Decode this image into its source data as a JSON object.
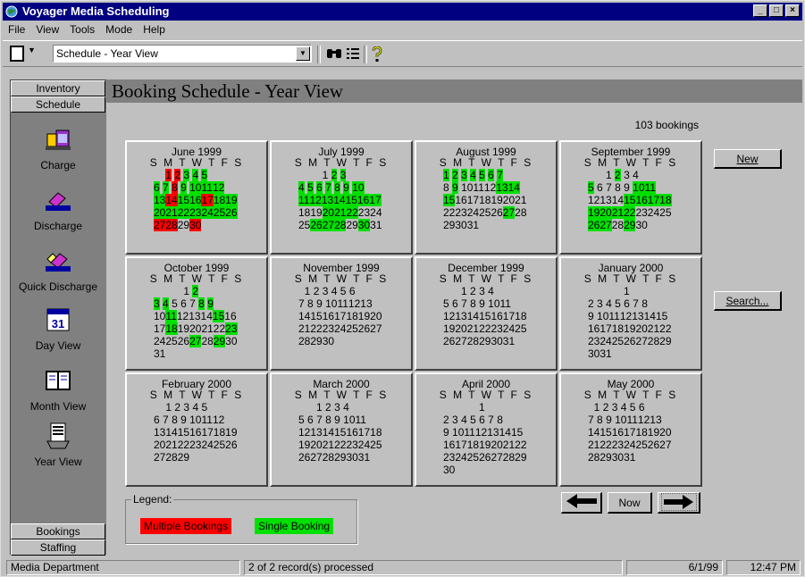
{
  "window": {
    "title": "Voyager Media Scheduling"
  },
  "menu": [
    {
      "label": "File"
    },
    {
      "label": "View"
    },
    {
      "label": "Tools"
    },
    {
      "label": "Mode"
    },
    {
      "label": "Help"
    }
  ],
  "toolbar": {
    "view_select_value": "Schedule - Year View"
  },
  "sidebar": {
    "top_buttons": [
      "Inventory",
      "Schedule"
    ],
    "items": [
      {
        "label": "Charge",
        "icon": "charge-icon"
      },
      {
        "label": "Discharge",
        "icon": "discharge-icon"
      },
      {
        "label": "Quick Discharge",
        "icon": "quick-discharge-icon"
      },
      {
        "label": "Day View",
        "icon": "day-view-icon"
      },
      {
        "label": "Month View",
        "icon": "month-view-icon"
      },
      {
        "label": "Year View",
        "icon": "year-view-icon"
      }
    ],
    "bottom_buttons": [
      "Bookings",
      "Staffing"
    ],
    "day_icon_number": "31"
  },
  "main": {
    "title": "Booking Schedule - Year View",
    "bookings_count": "103 bookings",
    "dow_header": "S M T W T F S",
    "months": [
      {
        "name": "June 1999",
        "start": 2,
        "days": 30,
        "multiple": [
          1,
          2,
          8,
          14,
          17,
          27,
          28,
          30
        ],
        "single": [
          3,
          4,
          5,
          6,
          7,
          9,
          10,
          11,
          12,
          13,
          15,
          16,
          18,
          19,
          20,
          21,
          22,
          23,
          24,
          25,
          26
        ]
      },
      {
        "name": "July 1999",
        "start": 4,
        "days": 31,
        "multiple": [],
        "single": [
          2,
          3,
          4,
          5,
          6,
          7,
          8,
          9,
          10,
          11,
          12,
          13,
          14,
          15,
          16,
          17,
          20,
          21,
          22,
          26,
          27,
          28,
          30
        ]
      },
      {
        "name": "August 1999",
        "start": 0,
        "days": 31,
        "multiple": [],
        "single": [
          1,
          2,
          3,
          4,
          5,
          6,
          7,
          9,
          13,
          14,
          15,
          27
        ]
      },
      {
        "name": "September 1999",
        "start": 3,
        "days": 30,
        "multiple": [],
        "single": [
          2,
          5,
          10,
          11,
          15,
          16,
          17,
          18,
          19,
          20,
          21,
          22,
          26,
          27,
          29
        ]
      },
      {
        "name": "October 1999",
        "start": 5,
        "days": 31,
        "multiple": [],
        "single": [
          2,
          3,
          4,
          8,
          9,
          11,
          15,
          18,
          23,
          27,
          29
        ]
      },
      {
        "name": "November 1999",
        "start": 1,
        "days": 30,
        "multiple": [],
        "single": []
      },
      {
        "name": "December 1999",
        "start": 3,
        "days": 31,
        "multiple": [],
        "single": []
      },
      {
        "name": "January 2000",
        "start": 6,
        "days": 31,
        "multiple": [],
        "single": []
      },
      {
        "name": "February 2000",
        "start": 2,
        "days": 29,
        "multiple": [],
        "single": []
      },
      {
        "name": "March 2000",
        "start": 3,
        "days": 31,
        "multiple": [],
        "single": []
      },
      {
        "name": "April 2000",
        "start": 6,
        "days": 30,
        "multiple": [],
        "single": []
      },
      {
        "name": "May 2000",
        "start": 1,
        "days": 31,
        "multiple": [],
        "single": []
      }
    ],
    "buttons": {
      "new": "New",
      "search": "Search...",
      "now": "Now"
    },
    "legend": {
      "title": "Legend:",
      "multiple_label": "Multiple Bookings",
      "single_label": "Single Booking",
      "multiple_color": "#ff0000",
      "single_color": "#00e000"
    }
  },
  "status": {
    "department": "Media Department",
    "records": "2 of 2 record(s) processed",
    "date": "6/1/99",
    "time": "12:47 PM"
  }
}
